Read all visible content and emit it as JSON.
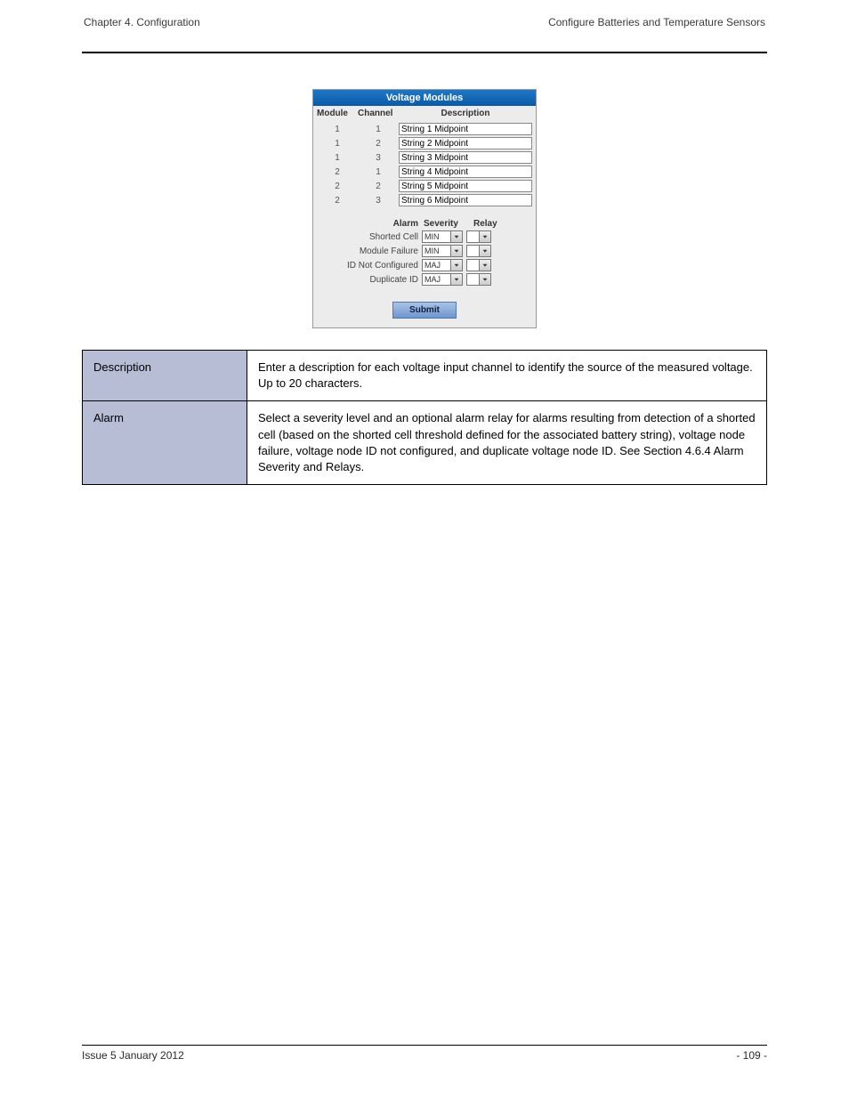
{
  "header": {
    "left": "Chapter 4. Configuration",
    "right": "Configure Batteries and Temperature Sensors"
  },
  "panel": {
    "title": "Voltage Modules",
    "cols": {
      "module": "Module",
      "channel": "Channel",
      "description": "Description"
    },
    "rows": [
      {
        "module": "1",
        "channel": "1",
        "desc": "String 1 Midpoint"
      },
      {
        "module": "1",
        "channel": "2",
        "desc": "String 2 Midpoint"
      },
      {
        "module": "1",
        "channel": "3",
        "desc": "String 3 Midpoint"
      },
      {
        "module": "2",
        "channel": "1",
        "desc": "String 4 Midpoint"
      },
      {
        "module": "2",
        "channel": "2",
        "desc": "String 5 Midpoint"
      },
      {
        "module": "2",
        "channel": "3",
        "desc": "String 6 Midpoint"
      }
    ],
    "alarm_header": {
      "alarm": "Alarm",
      "severity": "Severity",
      "relay": "Relay"
    },
    "alarms": [
      {
        "name": "Shorted Cell",
        "sev": "MIN"
      },
      {
        "name": "Module Failure",
        "sev": "MIN"
      },
      {
        "name": "ID Not Configured",
        "sev": "MAJ"
      },
      {
        "name": "Duplicate ID",
        "sev": "MAJ"
      }
    ],
    "submit": "Submit"
  },
  "defs": [
    {
      "term": "Description",
      "text": "Enter a description for each voltage input channel to identify the source of the measured voltage. Up to 20 characters."
    },
    {
      "term": "Alarm",
      "text": "Select a severity level and an optional alarm relay for alarms resulting from detection of a shorted cell (based on the shorted cell threshold defined for the associated battery string), voltage node failure, voltage node ID not configured, and duplicate voltage node ID. See Section 4.6.4 Alarm Severity and Relays."
    }
  ],
  "footer": {
    "left": "Issue 5 January 2012",
    "right": "- 109 -"
  }
}
